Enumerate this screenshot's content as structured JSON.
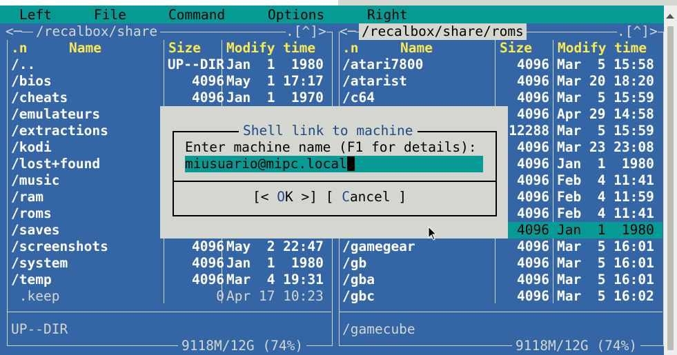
{
  "menu": {
    "left": "Left",
    "file": "File",
    "command": "Command",
    "options": "Options",
    "right": "Right"
  },
  "left_panel": {
    "path": "/recalbox/share",
    "corner": ".[^]>",
    "headers": {
      "n": ".n",
      "name": "Name",
      "size": "Size",
      "modify": "Modify time"
    },
    "rows": [
      {
        "name": "/..",
        "size": "UP--DIR",
        "date": "Jan  1  1980"
      },
      {
        "name": "/bios",
        "size": "4096",
        "date": "May  1 17:17"
      },
      {
        "name": "/cheats",
        "size": "4096",
        "date": "Jan  1  1970"
      },
      {
        "name": "/emulateurs",
        "size": "",
        "date": ""
      },
      {
        "name": "/extractions",
        "size": "",
        "date": ""
      },
      {
        "name": "/kodi",
        "size": "",
        "date": ""
      },
      {
        "name": "/lost+found",
        "size": "",
        "date": ""
      },
      {
        "name": "/music",
        "size": "",
        "date": ""
      },
      {
        "name": "/ram",
        "size": "",
        "date": ""
      },
      {
        "name": "/roms",
        "size": "",
        "date": ""
      },
      {
        "name": "/saves",
        "size": "",
        "date": ""
      },
      {
        "name": "/screenshots",
        "size": "4096",
        "date": "May  2 22:47"
      },
      {
        "name": "/system",
        "size": "4096",
        "date": "Jan  1  1980"
      },
      {
        "name": "/temp",
        "size": "4096",
        "date": "Mar  4 19:31"
      },
      {
        "name": " .keep",
        "size": "0",
        "date": "Apr 17 10:23"
      }
    ],
    "status": "UP--DIR",
    "free": "9118M/12G (74%)"
  },
  "right_panel": {
    "path": "/recalbox/share/roms",
    "corner": ".[^]>",
    "headers": {
      "n": ".n",
      "name": "Name",
      "size": "Size",
      "modify": "Modify time"
    },
    "rows": [
      {
        "name": "/atari7800",
        "size": "4096",
        "date": "Mar  5 15:58"
      },
      {
        "name": "/atarist",
        "size": "4096",
        "date": "Mar 20 18:20"
      },
      {
        "name": "/c64",
        "size": "4096",
        "date": "Mar  5 15:59"
      },
      {
        "name": "",
        "size": "4096",
        "date": "Apr 29 14:58"
      },
      {
        "name": "",
        "size": "12288",
        "date": "Mar  5 15:59"
      },
      {
        "name": "",
        "size": "4096",
        "date": "Mar 23 23:08"
      },
      {
        "name": "",
        "size": "4096",
        "date": "Jan  1  1980"
      },
      {
        "name": "",
        "size": "4096",
        "date": "Feb  4 11:41"
      },
      {
        "name": "",
        "size": "4096",
        "date": "Feb  4 11:59"
      },
      {
        "name": "",
        "size": "4096",
        "date": "Feb  4 11:41"
      },
      {
        "name": "",
        "size": "4096",
        "date": "Jan  1  1980"
      },
      {
        "name": "/gamegear",
        "size": "4096",
        "date": "Mar  5 16:01"
      },
      {
        "name": "/gb",
        "size": "4096",
        "date": "Mar  5 16:01"
      },
      {
        "name": "/gba",
        "size": "4096",
        "date": "Mar  5 16:01"
      },
      {
        "name": "/gbc",
        "size": "4096",
        "date": "Mar  5 16:02"
      }
    ],
    "selected_index": 10,
    "status": "/gamecube",
    "free": "9118M/12G (74%)"
  },
  "dialog": {
    "title": "Shell link to machine",
    "prompt": "Enter machine name (F1 for details):",
    "input_value": "miusuario@mipc.local",
    "ok_prefix": "[< ",
    "ok_hot": "O",
    "ok_rest": "K >]",
    "cancel_prefix": "[ ",
    "cancel_hot": "C",
    "cancel_rest": "ancel ]"
  },
  "colors": {
    "panel_bg": "#3465a4",
    "menu_bg": "#069a95",
    "dialog_bg": "#d3d7cf",
    "header_fg": "#fce94f",
    "hotkey_fg": "#204a87"
  },
  "icons": {
    "scroll_up": "triangle-up",
    "mouse": "arrow-pointer"
  }
}
